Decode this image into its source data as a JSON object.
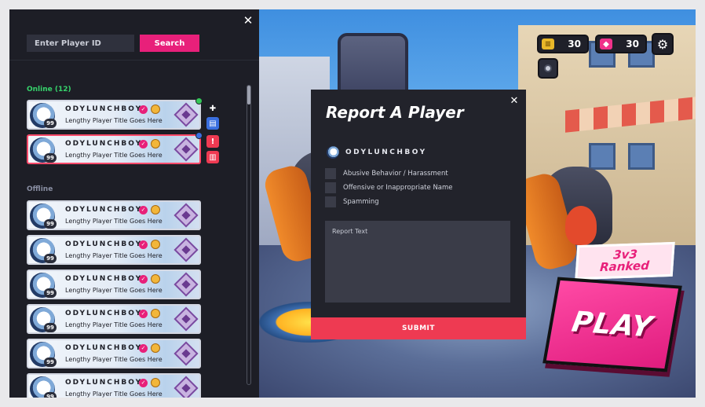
{
  "sidebar": {
    "search_placeholder": "Enter Player ID",
    "search_label": "Search",
    "online_header": "Online (12)",
    "offline_header": "Offline",
    "online_friends": [
      {
        "name": "ODYLUNCHBOY",
        "title": "Lengthy Player Title Goes Here",
        "level": "99",
        "status_color": "#34c759",
        "selected": false
      },
      {
        "name": "ODYLUNCHBOY",
        "title": "Lengthy Player Title Goes Here",
        "level": "99",
        "status_color": "#3a6fe0",
        "selected": true
      }
    ],
    "offline_friends": [
      {
        "name": "ODYLUNCHBOY",
        "title": "Lengthy Player Title Goes Here",
        "level": "99"
      },
      {
        "name": "ODYLUNCHBOY",
        "title": "Lengthy Player Title Goes Here",
        "level": "99"
      },
      {
        "name": "ODYLUNCHBOY",
        "title": "Lengthy Player Title Goes Here",
        "level": "99"
      },
      {
        "name": "ODYLUNCHBOY",
        "title": "Lengthy Player Title Goes Here",
        "level": "99"
      },
      {
        "name": "ODYLUNCHBOY",
        "title": "Lengthy Player Title Goes Here",
        "level": "99"
      },
      {
        "name": "ODYLUNCHBOY",
        "title": "Lengthy Player Title Goes Here",
        "level": "99"
      }
    ],
    "actions": [
      {
        "icon": "plus-icon",
        "glyph": "✚",
        "color": "#2f313d"
      },
      {
        "icon": "chat-icon",
        "glyph": "▤",
        "color": "#3a6fe0"
      },
      {
        "icon": "report-icon",
        "glyph": "!",
        "color": "#ee3a52"
      },
      {
        "icon": "trash-icon",
        "glyph": "▥",
        "color": "#ee3a52"
      }
    ]
  },
  "hud": {
    "coins": "30",
    "gems": "30"
  },
  "mode": {
    "label_line1": "3v3",
    "label_line2": "Ranked",
    "play_label": "PLAY"
  },
  "modal": {
    "title": "Report A Player",
    "player_name": "ODYLUNCHBOY",
    "options": [
      {
        "label": "Abusive Behavior / Harassment",
        "checked": false
      },
      {
        "label": "Offensive or Inappropriate Name",
        "checked": false
      },
      {
        "label": "Spamming",
        "checked": false
      }
    ],
    "report_placeholder": "Report Text",
    "submit_label": "SUBMIT"
  },
  "colors": {
    "accent": "#e8207a",
    "submit": "#ee3a52",
    "online": "#36d36b"
  }
}
